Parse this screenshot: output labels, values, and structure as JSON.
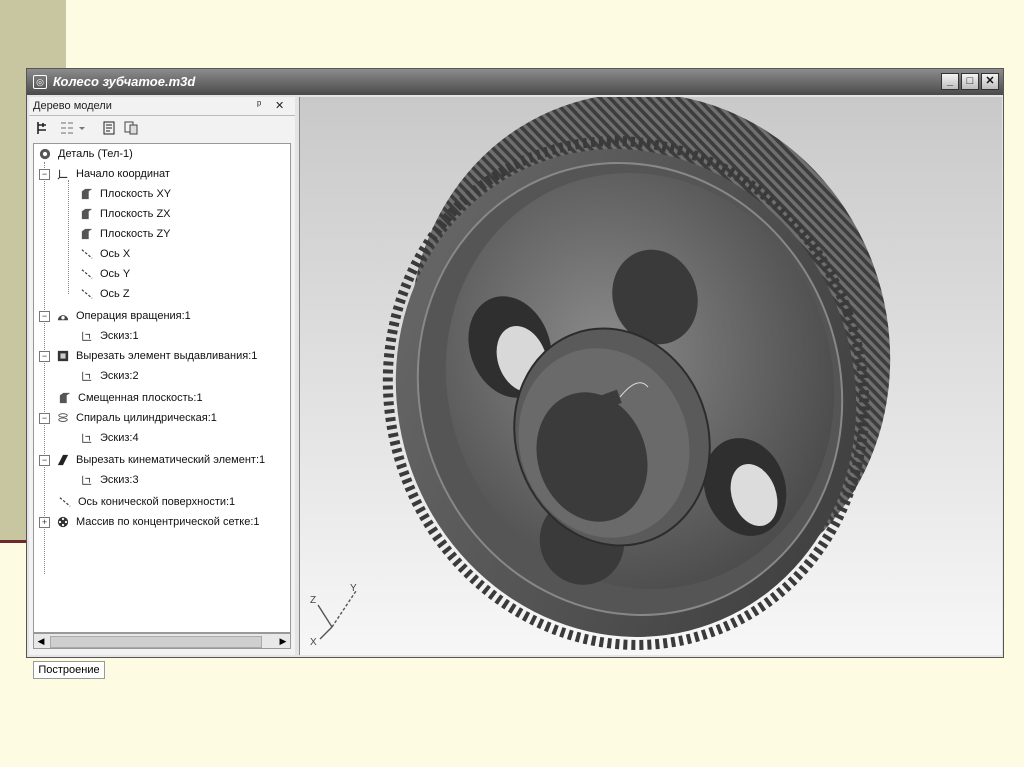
{
  "window": {
    "title": "Колесо зубчатое.m3d",
    "buttons": [
      "minimize",
      "maximize",
      "close"
    ]
  },
  "panel": {
    "title": "Дерево модели",
    "pin_glyph": "ᵖ",
    "close_glyph": "✕",
    "tab": "Построение"
  },
  "tree": [
    {
      "label": "Деталь (Тел-1)",
      "icon": "part-icon"
    },
    {
      "label": "Начало координат",
      "icon": "origin-icon"
    },
    {
      "label": "Плоскость XY",
      "icon": "plane-icon"
    },
    {
      "label": "Плоскость ZX",
      "icon": "plane-icon"
    },
    {
      "label": "Плоскость ZY",
      "icon": "plane-icon"
    },
    {
      "label": "Ось X",
      "icon": "axis-icon"
    },
    {
      "label": "Ось Y",
      "icon": "axis-icon"
    },
    {
      "label": "Ось Z",
      "icon": "axis-icon"
    },
    {
      "label": "Операция вращения:1",
      "icon": "revolve-icon"
    },
    {
      "label": "Эскиз:1",
      "icon": "sketch-icon"
    },
    {
      "label": "Вырезать элемент выдавливания:1",
      "icon": "extrude-cut-icon"
    },
    {
      "label": "Эскиз:2",
      "icon": "sketch-icon"
    },
    {
      "label": "Смещенная плоскость:1",
      "icon": "plane-icon"
    },
    {
      "label": "Спираль цилиндрическая:1",
      "icon": "helix-icon"
    },
    {
      "label": "Эскиз:4",
      "icon": "sketch-icon"
    },
    {
      "label": "Вырезать кинематический элемент:1",
      "icon": "sweep-cut-icon"
    },
    {
      "label": "Эскиз:3",
      "icon": "sketch-icon"
    },
    {
      "label": "Ось конической поверхности:1",
      "icon": "axis-icon"
    },
    {
      "label": "Массив по концентрической сетке:1",
      "icon": "pattern-icon"
    }
  ],
  "viewport": {
    "axes": {
      "z": "Z",
      "x": "X",
      "y": "Y"
    },
    "model": "gear-wheel"
  }
}
